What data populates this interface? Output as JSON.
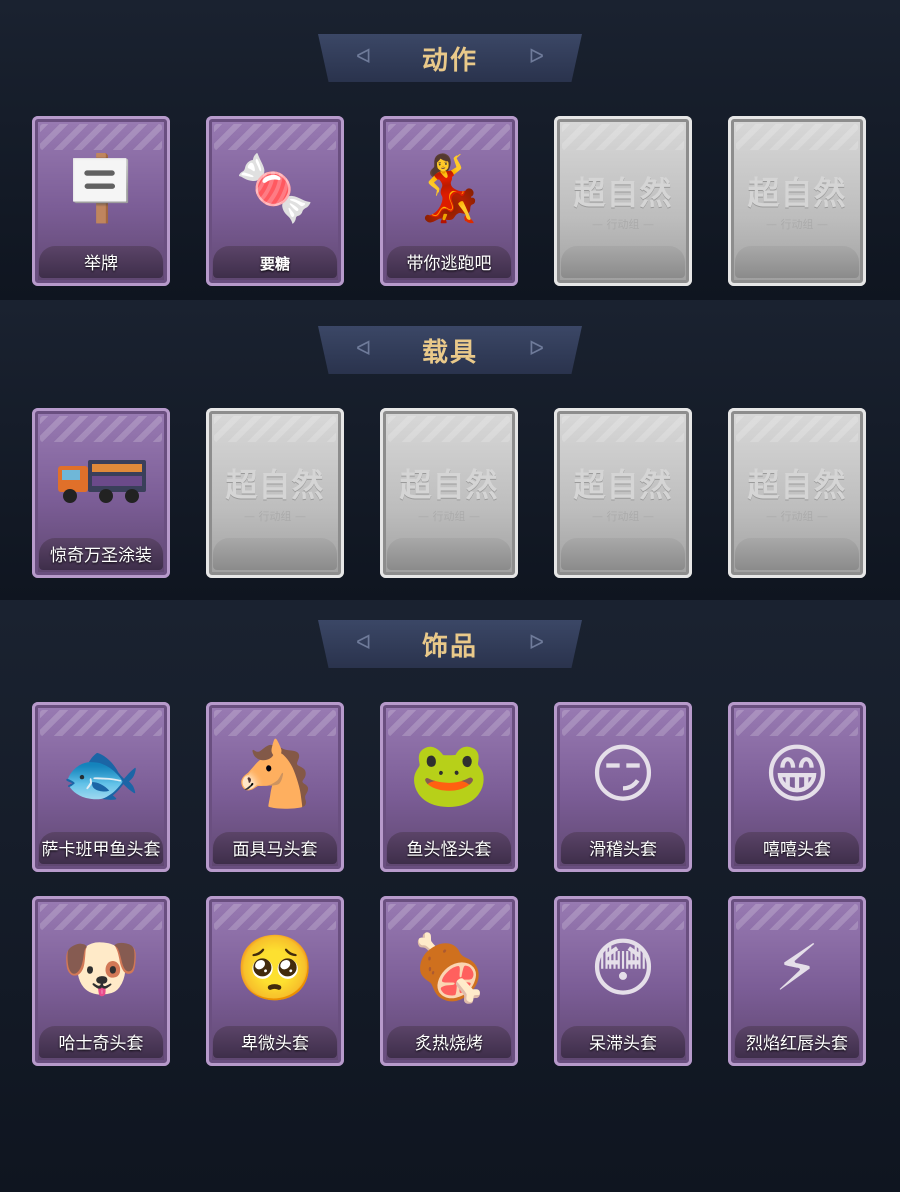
{
  "sections": [
    {
      "title": "动作"
    },
    {
      "title": "载具"
    },
    {
      "title": "饰品"
    }
  ],
  "actions": [
    {
      "label": "举牌",
      "icon": "sign-holding-icon",
      "glyph": "🪧",
      "locked": false
    },
    {
      "label": "要糖",
      "icon": "ask-candy-icon",
      "glyph": "🍬",
      "locked": false
    },
    {
      "label": "带你逃跑吧",
      "icon": "dance-escape-icon",
      "glyph": "💃",
      "locked": false
    },
    {
      "label": "",
      "icon": "locked-placeholder-icon",
      "locked": true
    },
    {
      "label": "",
      "icon": "locked-placeholder-icon",
      "locked": true
    }
  ],
  "vehicles": [
    {
      "label": "惊奇万圣涂装",
      "icon": "truck-icon",
      "locked": false
    },
    {
      "label": "",
      "icon": "locked-placeholder-icon",
      "locked": true
    },
    {
      "label": "",
      "icon": "locked-placeholder-icon",
      "locked": true
    },
    {
      "label": "",
      "icon": "locked-placeholder-icon",
      "locked": true
    },
    {
      "label": "",
      "icon": "locked-placeholder-icon",
      "locked": true
    }
  ],
  "accessories": [
    {
      "label": "萨卡班甲鱼头套",
      "icon": "fish-mask-icon",
      "glyph": "🐟"
    },
    {
      "label": "面具马头套",
      "icon": "horse-mask-icon",
      "glyph": "🐴"
    },
    {
      "label": "鱼头怪头套",
      "icon": "fish-monster-mask-icon",
      "glyph": "🐸"
    },
    {
      "label": "滑稽头套",
      "icon": "smirk-face-icon",
      "glyph": "😏"
    },
    {
      "label": "嘻嘻头套",
      "icon": "grin-face-icon",
      "glyph": "😁"
    },
    {
      "label": "哈士奇头套",
      "icon": "husky-mask-icon",
      "glyph": "🐶"
    },
    {
      "label": "卑微头套",
      "icon": "humble-face-icon",
      "glyph": "🥺"
    },
    {
      "label": "炙热烧烤",
      "icon": "bbq-meat-icon",
      "glyph": "🍖"
    },
    {
      "label": "呆滞头套",
      "icon": "dazed-face-icon",
      "glyph": "😳"
    },
    {
      "label": "烈焰红唇头套",
      "icon": "pikachu-mask-icon",
      "glyph": "⚡"
    }
  ],
  "placeholder": {
    "logo_main": "超自然",
    "logo_sub": "— 行动组 —"
  },
  "colors": {
    "title_gold": "#e9c98a",
    "card_purple": "#7b5d96",
    "locked_gray": "#bdbdbd"
  }
}
